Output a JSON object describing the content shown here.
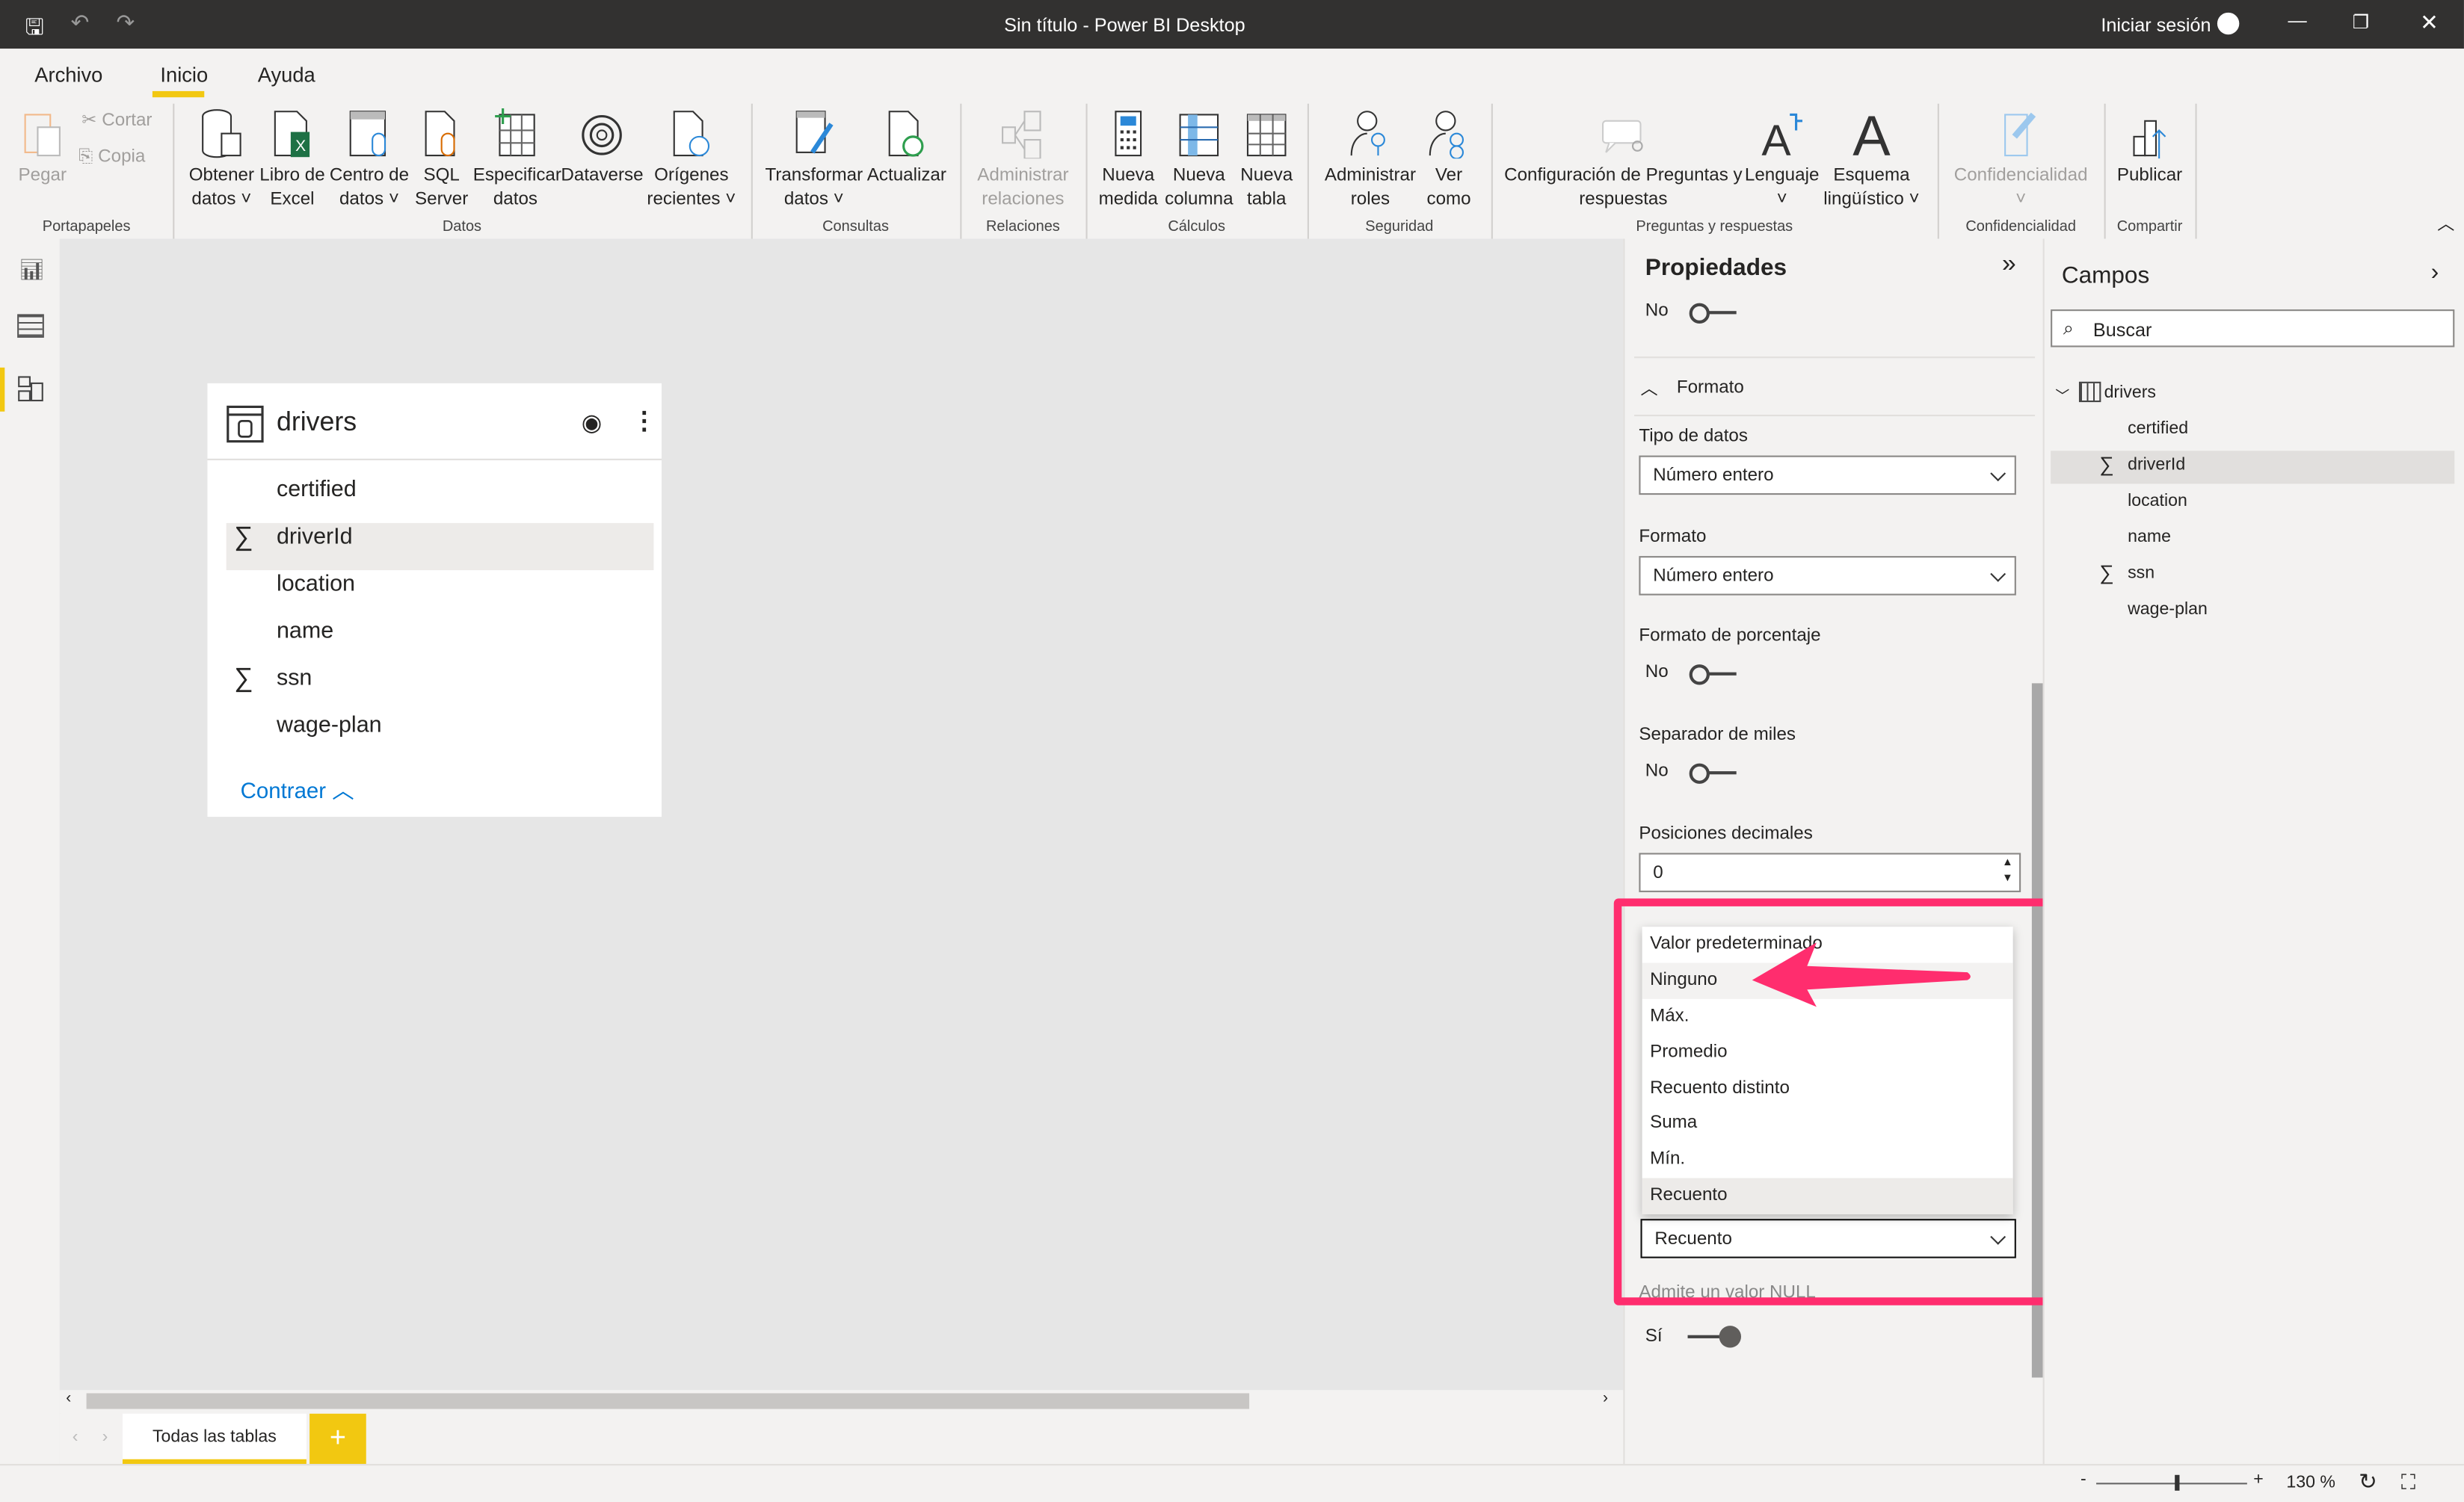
{
  "window": {
    "title": "Sin título - Power BI Desktop",
    "sign_in": "Iniciar sesión"
  },
  "menu": {
    "tabs": [
      "Archivo",
      "Inicio",
      "Ayuda"
    ],
    "active": "Inicio"
  },
  "ribbon": {
    "clipboard": {
      "paste": "Pegar",
      "cut": "Cortar",
      "copy": "Copia",
      "group": "Portapapeles"
    },
    "datos": {
      "items": [
        [
          "Obtener",
          "datos ˅"
        ],
        [
          "Libro de",
          "Excel"
        ],
        [
          "Centro de",
          "datos ˅"
        ],
        [
          "SQL",
          "Server"
        ],
        [
          "Especificar",
          "datos"
        ],
        [
          "Dataverse",
          ""
        ],
        [
          "Orígenes",
          "recientes ˅"
        ]
      ],
      "group": "Datos"
    },
    "consultas": {
      "items": [
        [
          "Transformar",
          "datos ˅"
        ],
        [
          "Actualizar",
          ""
        ]
      ],
      "group": "Consultas"
    },
    "relaciones": {
      "items": [
        [
          "Administrar",
          "relaciones"
        ]
      ],
      "group": "Relaciones"
    },
    "calculos": {
      "items": [
        [
          "Nueva",
          "medida"
        ],
        [
          "Nueva",
          "columna"
        ],
        [
          "Nueva",
          "tabla"
        ]
      ],
      "group": "Cálculos"
    },
    "seguridad": {
      "items": [
        [
          "Administrar",
          "roles"
        ],
        [
          "Ver",
          "como"
        ]
      ],
      "group": "Seguridad"
    },
    "qa": {
      "items": [
        [
          "Configuración de Preguntas y",
          "respuestas"
        ],
        [
          "Lenguaje",
          "˅"
        ],
        [
          "Esquema",
          "lingüístico ˅"
        ]
      ],
      "group": "Preguntas y respuestas"
    },
    "confidencialidad": {
      "items": [
        [
          "Confidencialidad",
          "˅"
        ]
      ],
      "group": "Confidencialidad"
    },
    "compartir": {
      "items": [
        [
          "Publicar",
          ""
        ]
      ],
      "group": "Compartir"
    }
  },
  "table_card": {
    "title": "drivers",
    "fields": [
      {
        "name": "certified",
        "sigma": false
      },
      {
        "name": "driverId",
        "sigma": true,
        "selected": true
      },
      {
        "name": "location",
        "sigma": false
      },
      {
        "name": "name",
        "sigma": false
      },
      {
        "name": "ssn",
        "sigma": true
      },
      {
        "name": "wage-plan",
        "sigma": false
      }
    ],
    "collapse": "Contraer"
  },
  "tabs": {
    "all_tables": "Todas las tablas",
    "add": "+"
  },
  "properties": {
    "title": "Propiedades",
    "top_toggle": "No",
    "section": "Formato",
    "data_type_label": "Tipo de datos",
    "data_type": "Número entero",
    "format_label": "Formato",
    "format": "Número entero",
    "percent_label": "Formato de porcentaje",
    "percent": "No",
    "thousands_label": "Separador de miles",
    "thousands": "No",
    "decimals_label": "Posiciones decimales",
    "decimals": "0",
    "summarize_options": [
      "Valor predeterminado",
      "Ninguno",
      "Máx.",
      "Promedio",
      "Recuento distinto",
      "Suma",
      "Mín.",
      "Recuento"
    ],
    "summarize": "Recuento",
    "null_label": "Admite un valor NULL",
    "null_value": "Sí"
  },
  "campos": {
    "title": "Campos",
    "search_placeholder": "Buscar",
    "table": "drivers",
    "fields": [
      {
        "name": "certified",
        "sigma": false
      },
      {
        "name": "driverId",
        "sigma": true,
        "selected": true
      },
      {
        "name": "location",
        "sigma": false
      },
      {
        "name": "name",
        "sigma": false
      },
      {
        "name": "ssn",
        "sigma": true
      },
      {
        "name": "wage-plan",
        "sigma": false
      }
    ]
  },
  "status": {
    "zoom": "130 %",
    "minus": "-",
    "plus": "+"
  },
  "colors": {
    "accent": "#f2c811",
    "annotation": "#ff2d6e",
    "titlebar": "#323130",
    "link": "#0078d4"
  }
}
